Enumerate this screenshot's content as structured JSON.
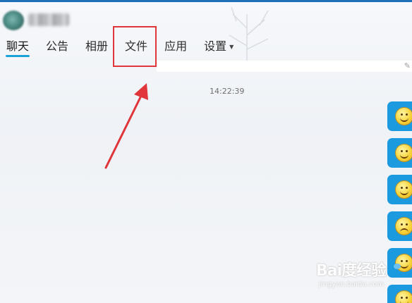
{
  "header": {
    "group_name": "",
    "tabs": [
      {
        "label": "聊天",
        "active": true
      },
      {
        "label": "公告",
        "active": false
      },
      {
        "label": "相册",
        "active": false
      },
      {
        "label": "文件",
        "active": false
      },
      {
        "label": "应用",
        "active": false
      },
      {
        "label": "设置",
        "active": false,
        "dropdown": true
      }
    ]
  },
  "chat": {
    "timestamp": "14:22:39",
    "messages": [
      {
        "type": "emoji",
        "icon": "smile-emoji-icon"
      },
      {
        "type": "emoji",
        "icon": "smile-emoji-icon"
      },
      {
        "type": "emoji",
        "icon": "smile-emoji-icon"
      },
      {
        "type": "emoji",
        "icon": "crying-emoji-icon"
      },
      {
        "type": "emoji",
        "icon": "laughing-tears-emoji-icon"
      },
      {
        "type": "emoji",
        "icon": "smile-emoji-icon"
      }
    ]
  },
  "annotation": {
    "highlight_color": "#e0353a",
    "arrow_color": "#e0353a"
  },
  "colors": {
    "accent": "#1aa3d9",
    "bubble": "#1b9ae0",
    "top_border": "#1d6fb8"
  },
  "watermark": {
    "text": "Bai度经验",
    "sub": "jingyan.baidu.com"
  }
}
